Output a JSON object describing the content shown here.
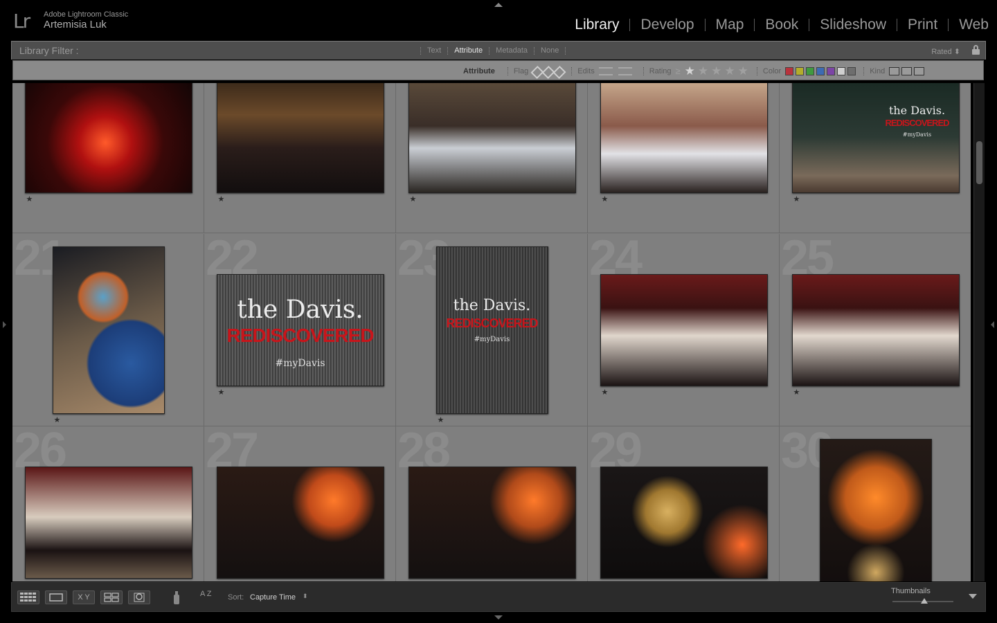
{
  "app": {
    "product": "Adobe Lightroom Classic",
    "user": "Artemisia Luk",
    "logo_text": "Lr"
  },
  "modules": [
    "Library",
    "Develop",
    "Map",
    "Book",
    "Slideshow",
    "Print",
    "Web"
  ],
  "active_module": "Library",
  "library_filter": {
    "title": "Library Filter :",
    "modes": [
      "Text",
      "Attribute",
      "Metadata",
      "None"
    ],
    "active_mode": "Attribute",
    "preset": "Rated",
    "lock_icon": "lock-icon"
  },
  "attribute_bar": {
    "label": "Attribute",
    "flag": "Flag",
    "edits": "Edits",
    "rating": "Rating",
    "rating_op": "≥",
    "rating_value": 1,
    "color": "Color",
    "kind": "Kind",
    "colors": [
      "#b8323c",
      "#b3ad2c",
      "#3f9a3f",
      "#3d6bb3",
      "#7c45a6",
      "#d0d0d0",
      "#6e6e6e"
    ]
  },
  "grid": {
    "rows": [
      [
        {
          "index": "",
          "rating": "★",
          "photo": "red-candle-silhouettes"
        },
        {
          "index": "",
          "rating": "★",
          "photo": "screens-crowd"
        },
        {
          "index": "",
          "rating": "★",
          "photo": "party-table-cowboy-hat"
        },
        {
          "index": "",
          "rating": "★",
          "photo": "party-crowd-table"
        },
        {
          "index": "",
          "rating": "★",
          "photo": "davis-door-pumpkins"
        }
      ],
      [
        {
          "index": "21",
          "rating": "★",
          "photo": "painted-pumpkins"
        },
        {
          "index": "22",
          "rating": "★",
          "photo": "davis-sign"
        },
        {
          "index": "23",
          "rating": "★",
          "photo": "davis-window"
        },
        {
          "index": "24",
          "rating": "★",
          "photo": "three-friends-1"
        },
        {
          "index": "25",
          "rating": "★",
          "photo": "three-friends-2"
        }
      ],
      [
        {
          "index": "26",
          "rating": "",
          "photo": "three-friends-closeup"
        },
        {
          "index": "27",
          "rating": "",
          "photo": "food-lights-1"
        },
        {
          "index": "28",
          "rating": "",
          "photo": "food-lights-2"
        },
        {
          "index": "29",
          "rating": "",
          "photo": "cupcakes-tray"
        },
        {
          "index": "30",
          "rating": "",
          "photo": "food-platter-lights"
        }
      ]
    ],
    "sign": {
      "title": "the Davis.",
      "red": "REDISCOVERED",
      "tag": "#myDavis"
    }
  },
  "toolbar": {
    "sort_label": "Sort:",
    "sort_value": "Capture Time",
    "thumbnails_label": "Thumbnails",
    "thumbnail_size": 0.52,
    "view_buttons": [
      "grid-view-icon",
      "loupe-view-icon",
      "compare-view-icon",
      "survey-view-icon",
      "people-view-icon"
    ],
    "compare_label": "X Y",
    "sort_order_label": "A Z"
  }
}
